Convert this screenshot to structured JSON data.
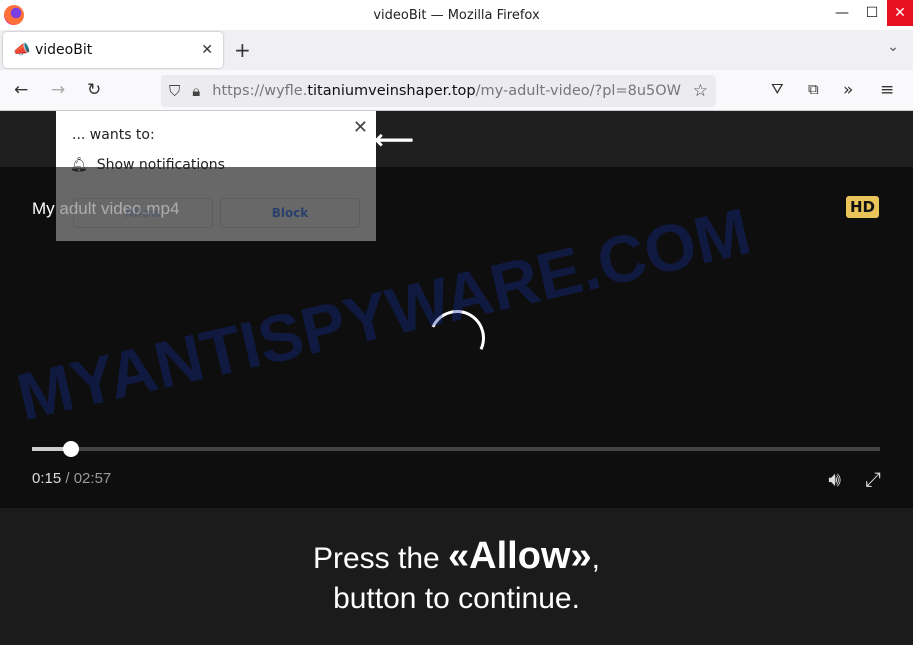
{
  "window": {
    "title": "videoBit — Mozilla Firefox"
  },
  "tab": {
    "title": "videoBit"
  },
  "url": {
    "prefix": "https://wyfle.",
    "domain": "titaniumveinshaper.top",
    "path": "/my-adult-video/?pl=8u5OW"
  },
  "popup": {
    "wants": "... wants to:",
    "permission": "Show notifications",
    "allow_label": "Allow",
    "block_label": "Block"
  },
  "video": {
    "title": "My adult video.mp4",
    "badge": "HD",
    "current_time": "0:15",
    "separator": " / ",
    "total_time": "02:57",
    "progress": 0.046
  },
  "message": {
    "pre": "Press the ",
    "highlight": "«Allow»",
    "post": ",",
    "line2": "button to continue."
  },
  "watermark": "MYANTISPYWARE.COM"
}
